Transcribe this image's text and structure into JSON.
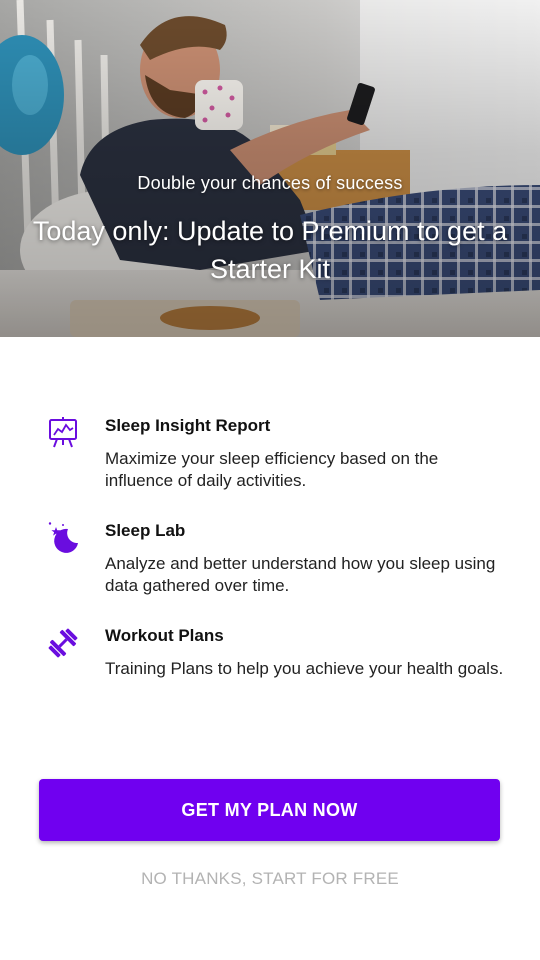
{
  "hero": {
    "subtitle": "Double your chances of success",
    "title": "Today only: Update to Premium to get a Starter Kit"
  },
  "features": [
    {
      "icon": "presentation-chart-icon",
      "title": "Sleep Insight Report",
      "description": "Maximize your sleep efficiency based on the influence of daily activities."
    },
    {
      "icon": "moon-stars-icon",
      "title": "Sleep Lab",
      "description": "Analyze and better understand how you sleep using data gathered over time."
    },
    {
      "icon": "dumbbell-icon",
      "title": "Workout Plans",
      "description": "Training Plans to help you achieve your health goals."
    }
  ],
  "actions": {
    "primary_label": "GET MY PLAN NOW",
    "secondary_label": "NO THANKS, START FOR FREE"
  },
  "colors": {
    "accent": "#7000f0",
    "secondary_text": "#b3b3b3"
  }
}
